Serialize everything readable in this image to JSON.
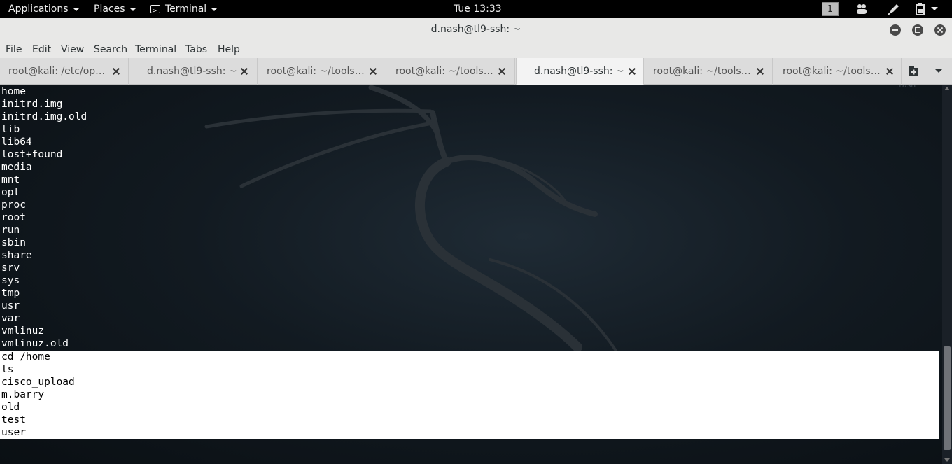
{
  "topbar": {
    "applications": "Applications",
    "places": "Places",
    "terminal_app": "Terminal",
    "clock": "Tue 13:33",
    "workspace": "1"
  },
  "window": {
    "title": "d.nash@tl9-ssh: ~"
  },
  "menubar": {
    "items": [
      "File",
      "Edit",
      "View",
      "Search",
      "Terminal",
      "Tabs",
      "Help"
    ]
  },
  "tabs": [
    {
      "label": "root@kali: /etc/op…",
      "active": false
    },
    {
      "label": "d.nash@tl9-ssh: ~",
      "active": false
    },
    {
      "label": "root@kali: ~/tools…",
      "active": false
    },
    {
      "label": "root@kali: ~/tools…",
      "active": false
    },
    {
      "label": "d.nash@tl9-ssh: ~",
      "active": true
    },
    {
      "label": "root@kali: ~/tools…",
      "active": false
    },
    {
      "label": "root@kali: ~/tools…",
      "active": false
    }
  ],
  "desktop": {
    "trash_label": "trash"
  },
  "terminal": {
    "lines": [
      "home",
      "initrd.img",
      "initrd.img.old",
      "lib",
      "lib64",
      "lost+found",
      "media",
      "mnt",
      "opt",
      "proc",
      "root",
      "run",
      "sbin",
      "share",
      "srv",
      "sys",
      "tmp",
      "usr",
      "var",
      "vmlinuz",
      "vmlinuz.old"
    ],
    "selected_lines": [
      "cd /home",
      "ls",
      "cisco_upload",
      "m.barry",
      "old",
      "test",
      "user"
    ]
  },
  "colors": {
    "panel_bg": "#000000",
    "window_chrome": "#e8e8e7",
    "terminal_text": "#ffffff",
    "selection_bg": "#ffffff"
  }
}
